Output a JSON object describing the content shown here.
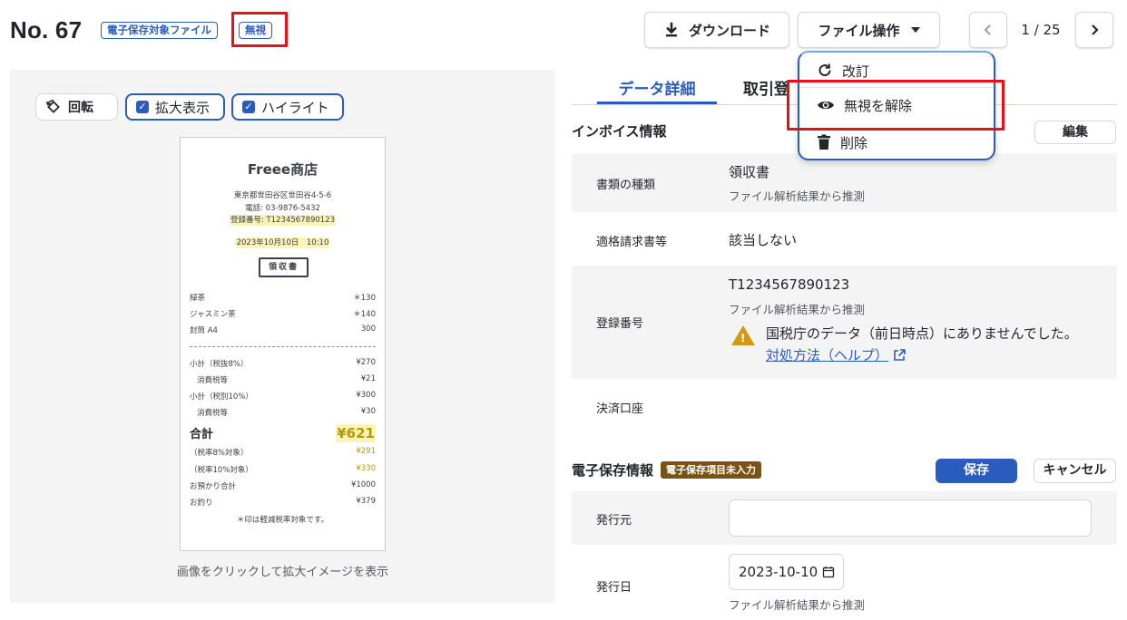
{
  "header": {
    "doc_no": "No. 67",
    "tag_estore": "電子保存対象ファイル",
    "tag_ignore": "無視",
    "download_label": "ダウンロード",
    "fileops_label": "ファイル操作",
    "pager": "1 / 25"
  },
  "file_menu": {
    "items": [
      {
        "label": "改訂",
        "icon": "refresh-icon"
      },
      {
        "label": "無視を解除",
        "icon": "eye-icon"
      },
      {
        "label": "削除",
        "icon": "trash-icon"
      }
    ]
  },
  "preview": {
    "rotate_label": "回転",
    "zoom_label": "拡大表示",
    "zoom_checked": true,
    "highlight_label": "ハイライト",
    "highlight_checked": true,
    "caption": "画像をクリックして拡大イメージを表示",
    "receipt": {
      "shop": "Freee商店",
      "address": "東京都世田谷区世田谷4-5-6",
      "phone": "電話: 03-9876-5432",
      "reg_no": "登録番号: T1234567890123",
      "datetime": "2023年10月10日　10:10",
      "stamp": "領収書",
      "items": [
        {
          "name": "緑茶",
          "price": "＊130"
        },
        {
          "name": "ジャスミン茶",
          "price": "＊140"
        },
        {
          "name": "封筒 A4",
          "price": "300"
        }
      ],
      "summary": [
        {
          "name": "小計（税抜8%）",
          "price": "¥270"
        },
        {
          "name": "消費税等",
          "price": "¥21"
        },
        {
          "name": "小計（税別10%）",
          "price": "¥300"
        },
        {
          "name": "消費税等",
          "price": "¥30"
        }
      ],
      "total_label": "合計",
      "total_value": "¥621",
      "breakdown": [
        {
          "name": "（税率8%対象）",
          "price": "¥291"
        },
        {
          "name": "（税率10%対象）",
          "price": "¥330"
        },
        {
          "name": "お預かり合計",
          "price": "¥1000"
        },
        {
          "name": "お釣り",
          "price": "¥379"
        }
      ],
      "note": "＊印は軽減税率対象です。"
    }
  },
  "detail": {
    "tabs": [
      "データ詳細",
      "取引登"
    ],
    "invoice_title": "インボイス情報",
    "edit_label": "編集",
    "rows": {
      "doc_type": {
        "label": "書類の種類",
        "value": "領収書",
        "sub": "ファイル解析結果から推測"
      },
      "qualified": {
        "label": "適格請求書等",
        "value": "該当しない"
      },
      "reg_no": {
        "label": "登録番号",
        "value": "T1234567890123",
        "sub": "ファイル解析結果から推測",
        "warning": "国税庁のデータ（前日時点）にありませんでした。",
        "help_link": "対処方法（ヘルプ）"
      },
      "account": {
        "label": "決済口座"
      }
    },
    "estore_title": "電子保存情報",
    "estore_badge": "電子保存項目未入力",
    "save_label": "保存",
    "cancel_label": "キャンセル",
    "issuer": {
      "label": "発行元",
      "value": ""
    },
    "issue_date": {
      "label": "発行日",
      "value": "2023-10-10",
      "sub": "ファイル解析結果から推測"
    }
  },
  "colors": {
    "accent": "#2a5cbe",
    "highlight_annotation": "#ea0f15",
    "warning": "#d39a10",
    "badge_brown": "#7a5212"
  }
}
